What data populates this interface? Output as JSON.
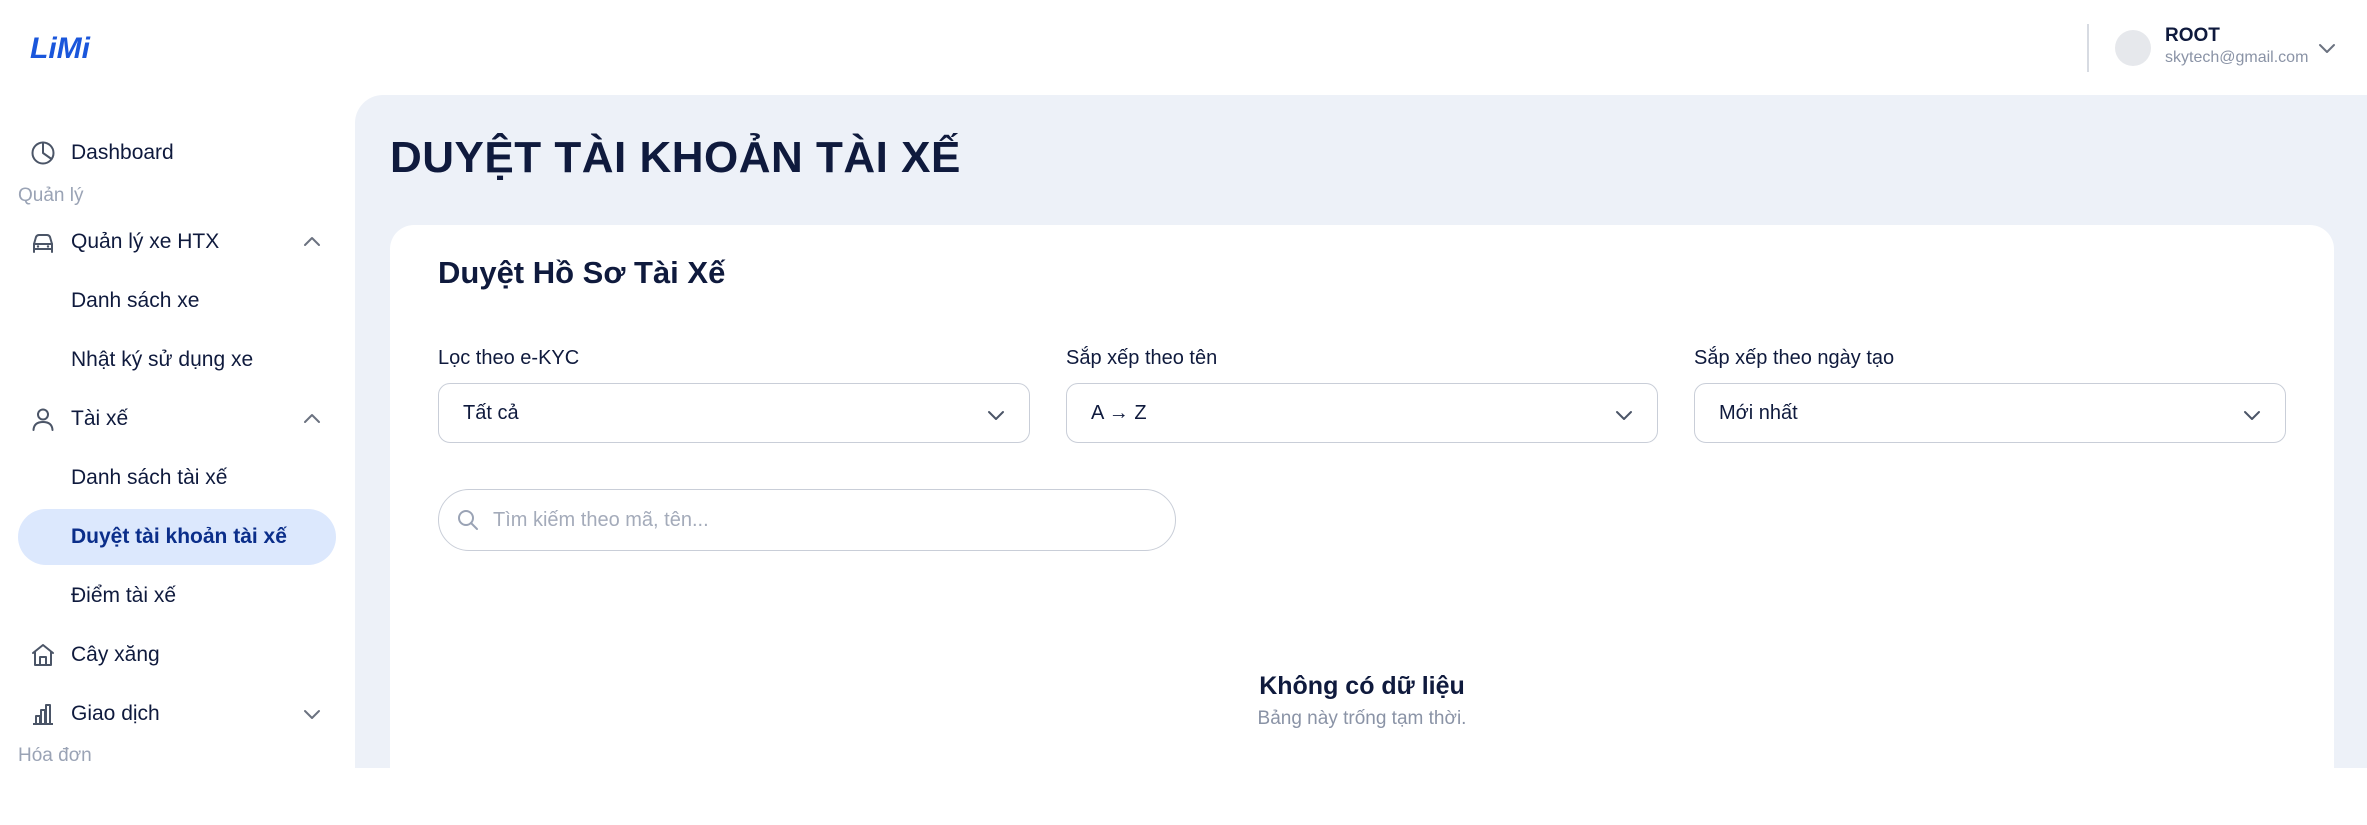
{
  "app": {
    "logo_text": "LiMi",
    "brand_color": "#1a56db"
  },
  "user": {
    "name": "ROOT",
    "email": "skytech@gmail.com"
  },
  "sidebar": {
    "dashboard": "Dashboard",
    "section_manage": "Quản lý",
    "vehicles": "Quản lý xe HTX",
    "vehicle_list": "Danh sách xe",
    "vehicle_log": "Nhật ký sử dụng xe",
    "drivers": "Tài xế",
    "driver_list": "Danh sách tài xế",
    "driver_approval": "Duyệt tài khoản tài xế",
    "driver_points": "Điểm tài xế",
    "gas_station": "Cây xăng",
    "transactions": "Giao dịch",
    "section_invoice": "Hóa đơn"
  },
  "page": {
    "title": "DUYỆT TÀI KHOẢN TÀI XẾ",
    "card_title": "Duyệt Hồ Sơ Tài Xế"
  },
  "filters": [
    {
      "label": "Lọc theo e-KYC",
      "value": "Tất cả"
    },
    {
      "label": "Sắp xếp theo tên",
      "value": "A → Z"
    },
    {
      "label": "Sắp xếp theo ngày tạo",
      "value": "Mới nhất"
    }
  ],
  "search": {
    "placeholder": "Tìm kiếm theo mã, tên..."
  },
  "empty": {
    "title": "Không có dữ liệu",
    "subtitle": "Bảng này trống tạm thời."
  }
}
